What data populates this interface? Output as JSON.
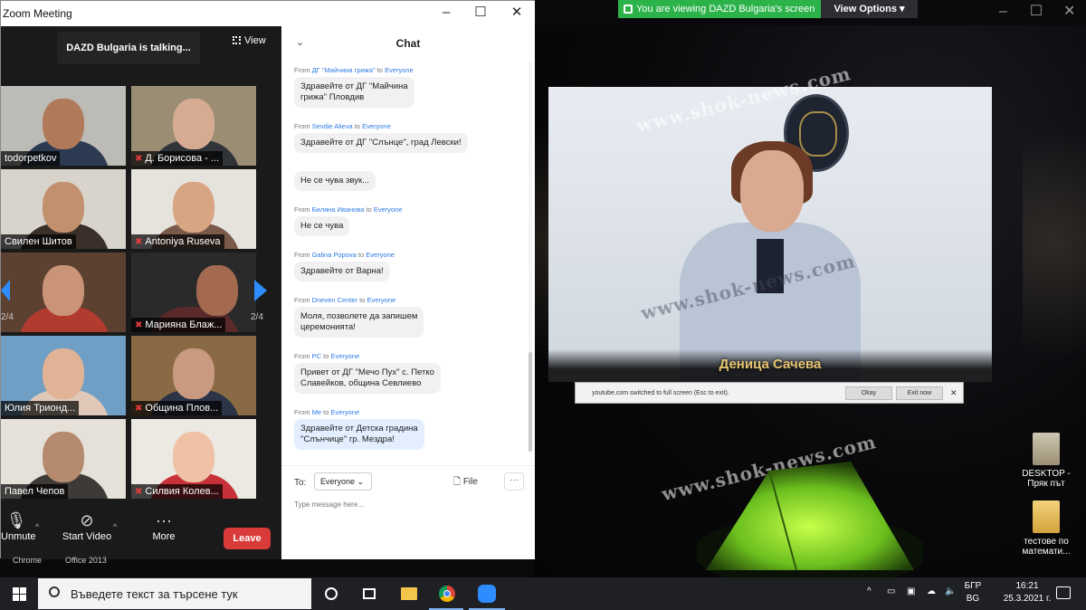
{
  "share_bar": {
    "text": "You are viewing DAZD Bulgaria's screen",
    "view_options": "View Options ▾"
  },
  "video": {
    "name_caption": "Деница Сачева",
    "watermark": "www.shok-news.com"
  },
  "youtube_notice": {
    "message": "youtube.com switched to full screen (Esc to exit).",
    "ok": "Okay",
    "exit": "Exit now"
  },
  "desktop": {
    "icons": [
      {
        "label": "DESKTOP -\nПряк път"
      },
      {
        "label": "тестове по\nматемати..."
      }
    ]
  },
  "zoom": {
    "title": "Zoom Meeting",
    "talking": "DAZD Bulgaria is talking...",
    "view_label": "View",
    "page_left": "2/4",
    "page_right": "2/4",
    "tiles": [
      {
        "label": "todorpetkov",
        "muted": false
      },
      {
        "label": "Д. Борисова - ...",
        "muted": true
      },
      {
        "label": "Свилен Шитов",
        "muted": false
      },
      {
        "label": "Antoniya Ruseva",
        "muted": true
      },
      {
        "label": "",
        "muted": false
      },
      {
        "label": "Марияна Блаж...",
        "muted": true
      },
      {
        "label": "Юлия Трионд...",
        "muted": false
      },
      {
        "label": "Община Плов...",
        "muted": true
      },
      {
        "label": "Павел Чепов",
        "muted": false
      },
      {
        "label": "Силвия Колев...",
        "muted": true
      }
    ],
    "toolbar": {
      "unmute": "Unmute",
      "start_video": "Start Video",
      "more": "More",
      "leave": "Leave"
    },
    "under_labels": {
      "left": "Chrome",
      "right": "Office 2013"
    }
  },
  "chat": {
    "title": "Chat",
    "messages": [
      {
        "sender": "ДГ \"Майчина грижа\"",
        "to": "Everyone",
        "lines": [
          "Здравейте от ДГ \"Майчина",
          "грижа\" Пловдив"
        ]
      },
      {
        "sender": "Sevdie Alieva",
        "to": "Everyone",
        "lines": [
          "Здравейте от ДГ \"Слънце\", град Левски!"
        ]
      },
      {
        "sender": "",
        "to": "",
        "lines": [
          "Не се чува звук..."
        ]
      },
      {
        "sender": "Биляна Иванова",
        "to": "Everyone",
        "lines": [
          "Не се чува"
        ]
      },
      {
        "sender": "Galina Popova",
        "to": "Everyone",
        "lines": [
          "Здравейте от Варна!"
        ]
      },
      {
        "sender": "Dneven Center",
        "to": "Everyone",
        "lines": [
          "Моля, позволете да запишем",
          "церемонията!"
        ]
      },
      {
        "sender": "PC",
        "to": "Everyone",
        "lines": [
          "Привет от ДГ \"Мечо Пух\" с. Петко",
          "Славейков, община Севлиево"
        ]
      },
      {
        "sender": "Me",
        "to": "Everyone",
        "lines": [
          "Здравейте от Детска градина",
          "\"Слънчице\" гр. Мездра!"
        ]
      }
    ],
    "from_word": "From",
    "to_word": "to",
    "to_label": "To:",
    "recipient": "Everyone",
    "file_label": "File",
    "more_label": "···",
    "input_placeholder": "Type message here..."
  },
  "taskbar": {
    "search_placeholder": "Въведете текст за търсене тук",
    "lang_top": "БГР",
    "lang_bottom": "BG",
    "time": "16:21",
    "date": "25.3.2021 г."
  },
  "colors": {
    "zoom_blue": "#2d7be5",
    "leave_red": "#d93a3a",
    "share_green": "#2bb34a"
  }
}
